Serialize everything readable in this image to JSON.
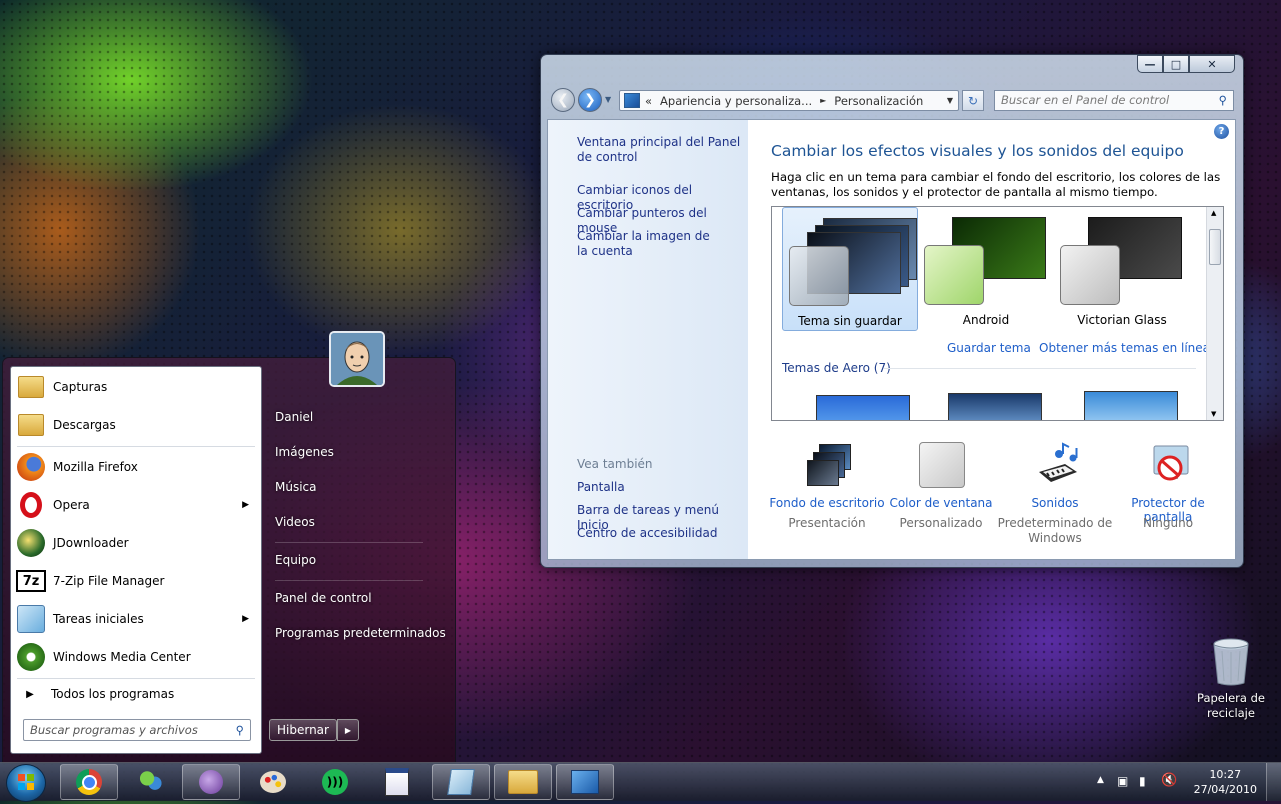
{
  "desktop": {
    "recycle_bin_label": "Papelera de reciclaje"
  },
  "window": {
    "address": {
      "prefix": "«",
      "crumb1": "Apariencia y personaliza...",
      "crumb2": "Personalización"
    },
    "search_placeholder": "Buscar en el Panel de control",
    "left_links": [
      "Ventana principal del Panel de control",
      "Cambiar iconos del escritorio",
      "Cambiar punteros del mouse",
      "Cambiar la imagen de la cuenta"
    ],
    "see_also": {
      "heading": "Vea también",
      "items": [
        "Pantalla",
        "Barra de tareas y menú Inicio",
        "Centro de accesibilidad"
      ]
    },
    "title": "Cambiar los efectos visuales y los sonidos del equipo",
    "description": "Haga clic en un tema para cambiar el fondo del escritorio, los colores de las ventanas, los sonidos y el protector de pantalla al mismo tiempo.",
    "themes": [
      {
        "name": "Tema sin guardar",
        "selected": true
      },
      {
        "name": "Android",
        "selected": false
      },
      {
        "name": "Victorian Glass",
        "selected": false
      }
    ],
    "save_theme": "Guardar tema",
    "more_themes": "Obtener más temas en línea",
    "aero_group": "Temas de Aero (7)",
    "bottom": [
      {
        "title": "Fondo de escritorio",
        "sub": "Presentación"
      },
      {
        "title": "Color de ventana",
        "sub": "Personalizado"
      },
      {
        "title": "Sonidos",
        "sub": "Predeterminado de Windows"
      },
      {
        "title": "Protector de pantalla",
        "sub": "Ninguno"
      }
    ]
  },
  "start_menu": {
    "programs": [
      {
        "label": "Capturas",
        "icon": "folder-icon",
        "arrow": false
      },
      {
        "label": "Descargas",
        "icon": "folder-icon",
        "arrow": false
      },
      {
        "label": "Mozilla Firefox",
        "icon": "firefox-icon",
        "arrow": false
      },
      {
        "label": "Opera",
        "icon": "opera-icon",
        "arrow": true
      },
      {
        "label": "JDownloader",
        "icon": "jdownloader-icon",
        "arrow": false
      },
      {
        "label": "7-Zip File Manager",
        "icon": "7zip-icon",
        "arrow": false
      },
      {
        "label": "Tareas iniciales",
        "icon": "tasks-icon",
        "arrow": true
      },
      {
        "label": "Windows Media Center",
        "icon": "media-center-icon",
        "arrow": false
      }
    ],
    "all_programs": "Todos los programas",
    "search_placeholder": "Buscar programas y archivos",
    "right_items": [
      "Daniel",
      "Imágenes",
      "Música",
      "Videos",
      "Equipo",
      "Panel de control",
      "Programas predeterminados"
    ],
    "shutdown_label": "Hibernar"
  },
  "taskbar": {
    "time": "10:27",
    "date": "27/04/2010"
  }
}
